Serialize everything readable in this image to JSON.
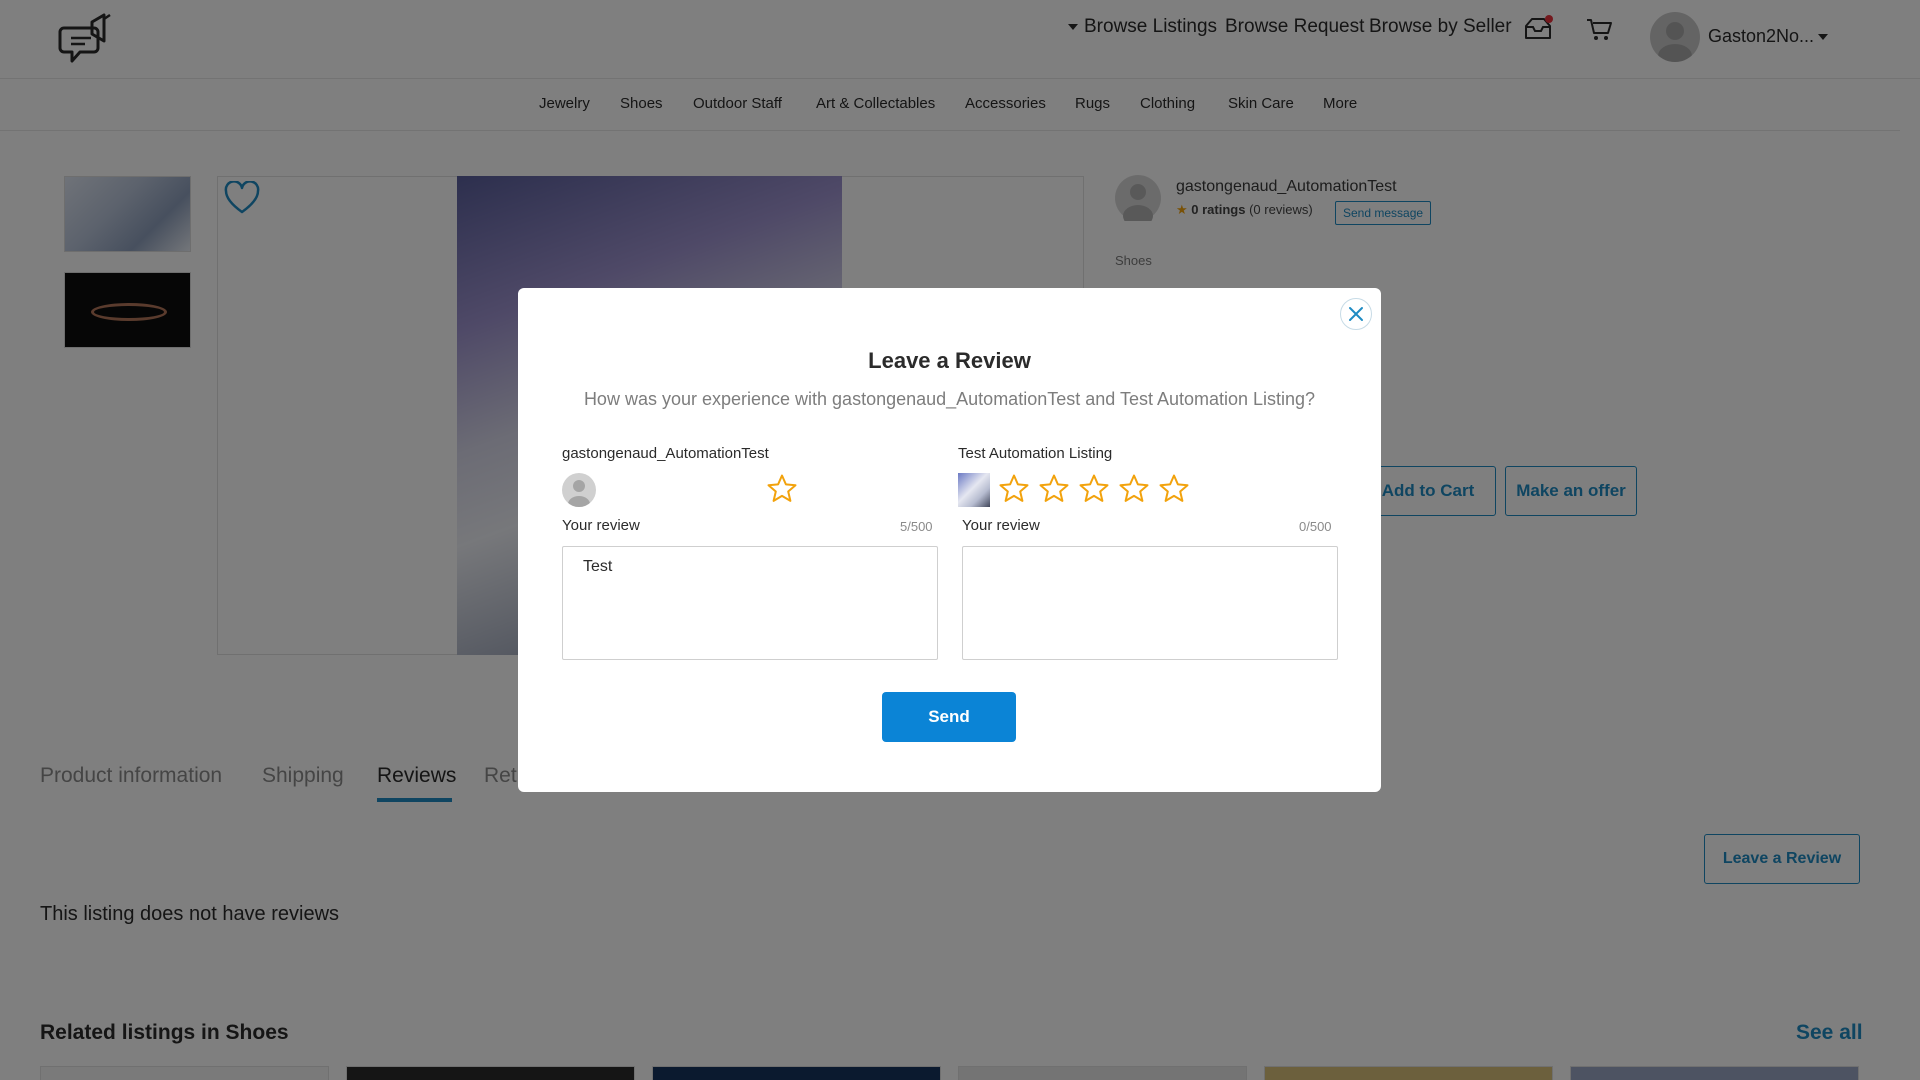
{
  "header": {
    "nav": {
      "browse_listings": "Browse Listings",
      "browse_request": "Browse Request",
      "browse_by_seller": "Browse by Seller"
    },
    "user_name": "Gaston2No..."
  },
  "categories": [
    "Jewelry",
    "Shoes",
    "Outdoor Staff",
    "Art & Collectables",
    "Accessories",
    "Rugs",
    "Clothing",
    "Skin Care",
    "More"
  ],
  "seller": {
    "name": "gastongenaud_AutomationTest",
    "ratings": "0 ratings",
    "reviews": "(0 reviews)",
    "send_message": "Send message",
    "category": "Shoes"
  },
  "actions": {
    "add_to_cart": "Add to Cart",
    "make_offer": "Make an offer"
  },
  "tabs": {
    "product_info": "Product information",
    "shipping": "Shipping",
    "reviews": "Reviews",
    "returns_partial": "Ret"
  },
  "reviews_section": {
    "leave_review": "Leave a Review",
    "empty_text": "This listing does not have reviews"
  },
  "related": {
    "title": "Related listings in Shoes",
    "see_all": "See all"
  },
  "modal": {
    "title": "Leave a Review",
    "subtitle": "How was your experience with gastongenaud_AutomationTest and Test Automation Listing?",
    "seller_label": "gastongenaud_AutomationTest",
    "listing_label": "Test Automation Listing",
    "your_review_label": "Your review",
    "seller_counter": "5/500",
    "listing_counter": "0/500",
    "seller_review_text": "Test",
    "listing_review_text": "",
    "send_label": "Send",
    "seller_star_count": 1,
    "listing_star_count": 5,
    "seller_rating_value": 0,
    "listing_rating_value": 0
  },
  "colors": {
    "accent": "#1e8bc3",
    "send_button": "#0b84d6",
    "star": "#f2a20c",
    "notification": "#e8323c"
  },
  "icons": [
    "megaphone-chat-logo-icon",
    "caret-down-icon",
    "inbox-icon",
    "cart-icon",
    "heart-icon",
    "star-icon",
    "close-icon"
  ]
}
